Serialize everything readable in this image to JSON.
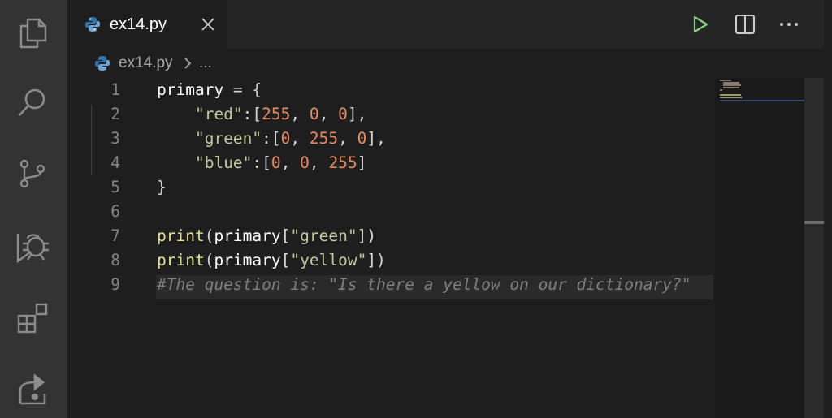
{
  "activity_bar": {
    "icons": [
      "explorer-icon",
      "search-icon",
      "source-control-icon",
      "run-debug-icon",
      "extensions-icon",
      "live-share-icon"
    ]
  },
  "tab": {
    "filename": "ex14.py"
  },
  "breadcrumb": {
    "file": "ex14.py",
    "ellipsis": "..."
  },
  "editor": {
    "line_numbers": [
      "1",
      "2",
      "3",
      "4",
      "5",
      "6",
      "7",
      "8",
      "9"
    ],
    "lines": [
      [
        {
          "t": "primary",
          "c": "id"
        },
        {
          "t": " = ",
          "c": "op"
        },
        {
          "t": "{",
          "c": "op"
        }
      ],
      [
        {
          "t": "    ",
          "c": "op"
        },
        {
          "t": "\"red\"",
          "c": "str"
        },
        {
          "t": ":[",
          "c": "op"
        },
        {
          "t": "255",
          "c": "num"
        },
        {
          "t": ", ",
          "c": "op"
        },
        {
          "t": "0",
          "c": "num"
        },
        {
          "t": ", ",
          "c": "op"
        },
        {
          "t": "0",
          "c": "num"
        },
        {
          "t": "],",
          "c": "op"
        }
      ],
      [
        {
          "t": "    ",
          "c": "op"
        },
        {
          "t": "\"green\"",
          "c": "str"
        },
        {
          "t": ":[",
          "c": "op"
        },
        {
          "t": "0",
          "c": "num"
        },
        {
          "t": ", ",
          "c": "op"
        },
        {
          "t": "255",
          "c": "num"
        },
        {
          "t": ", ",
          "c": "op"
        },
        {
          "t": "0",
          "c": "num"
        },
        {
          "t": "],",
          "c": "op"
        }
      ],
      [
        {
          "t": "    ",
          "c": "op"
        },
        {
          "t": "\"blue\"",
          "c": "str"
        },
        {
          "t": ":[",
          "c": "op"
        },
        {
          "t": "0",
          "c": "num"
        },
        {
          "t": ", ",
          "c": "op"
        },
        {
          "t": "0",
          "c": "num"
        },
        {
          "t": ", ",
          "c": "op"
        },
        {
          "t": "255",
          "c": "num"
        },
        {
          "t": "]",
          "c": "op"
        }
      ],
      [
        {
          "t": "}",
          "c": "op"
        }
      ],
      [],
      [
        {
          "t": "print",
          "c": "fn"
        },
        {
          "t": "(",
          "c": "op"
        },
        {
          "t": "primary",
          "c": "id"
        },
        {
          "t": "[",
          "c": "op"
        },
        {
          "t": "\"green\"",
          "c": "str"
        },
        {
          "t": "])",
          "c": "op"
        }
      ],
      [
        {
          "t": "print",
          "c": "fn"
        },
        {
          "t": "(",
          "c": "op"
        },
        {
          "t": "primary",
          "c": "id"
        },
        {
          "t": "[",
          "c": "op"
        },
        {
          "t": "\"yellow\"",
          "c": "str"
        },
        {
          "t": "])",
          "c": "op"
        }
      ],
      [
        {
          "t": "#The question is: \"Is there a yellow on our dictionary?\"",
          "c": "cm"
        }
      ]
    ]
  },
  "colors": {
    "run_icon": "#89d185",
    "python_icon_blue": "#3572a5",
    "string": "#c3c8a0",
    "number": "#e58a66",
    "function": "#e5e29a",
    "comment": "#7f7f7f"
  }
}
